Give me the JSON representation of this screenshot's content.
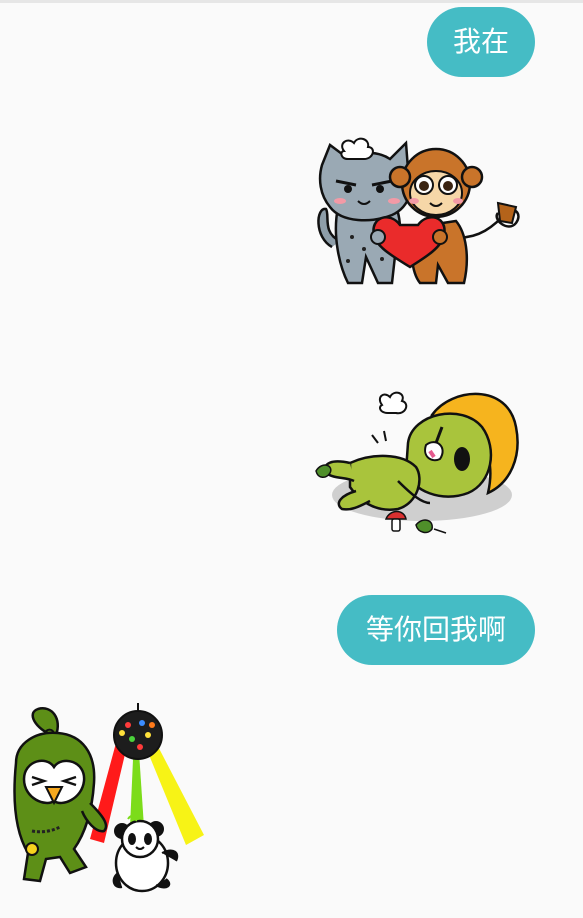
{
  "chat": {
    "messages": [
      {
        "type": "text",
        "text": "我在"
      },
      {
        "type": "sticker",
        "sticker": "cat-monkey-heart-sticker"
      },
      {
        "type": "sticker",
        "sticker": "lying-green-character-sticker"
      },
      {
        "type": "text",
        "text": "等你回我啊"
      },
      {
        "type": "sticker",
        "sticker": "owl-panda-disco-sticker"
      }
    ]
  },
  "colors": {
    "bubble": "#45bcc5",
    "background": "#fafafa"
  }
}
